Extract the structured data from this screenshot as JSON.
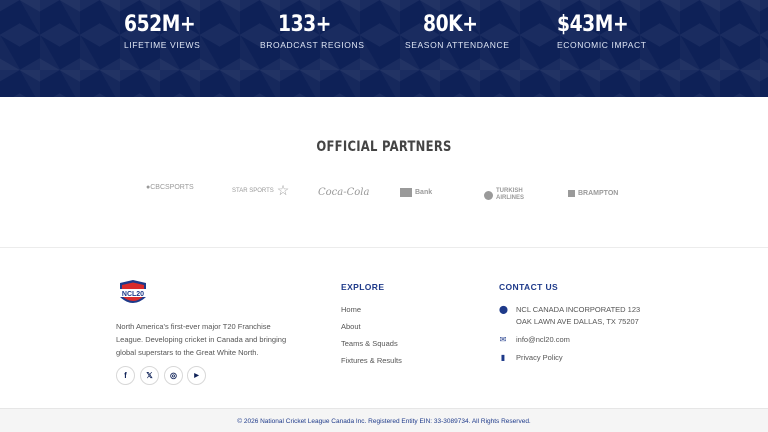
{
  "stats": [
    {
      "value": "652M+",
      "label": "LIFETIME VIEWS"
    },
    {
      "value": "133+",
      "label": "BROADCAST REGIONS"
    },
    {
      "value": "80K+",
      "label": "SEASON ATTENDANCE"
    },
    {
      "value": "$43M+",
      "label": "ECONOMIC IMPACT"
    }
  ],
  "partners": {
    "title": "OFFICIAL PARTNERS",
    "logos": [
      {
        "text": "●CBCSPORTS",
        "icon": "cbc-sports-logo"
      },
      {
        "text": "STAR SPORTS",
        "icon": "star-sports-logo"
      },
      {
        "text": "Coca-Cola",
        "icon": "coca-cola-logo"
      },
      {
        "text": "Bank",
        "icon": "td-bank-logo"
      },
      {
        "text": "TURKISH AIRLINES",
        "icon": "turkish-airlines-logo"
      },
      {
        "text": "BRAMPTON",
        "icon": "brampton-logo"
      }
    ]
  },
  "footer": {
    "about": "North America's first-ever major T20 Franchise League. Developing cricket in Canada and bringing global superstars to the Great White North.",
    "social": [
      {
        "icon": "facebook-icon",
        "glyph": "f"
      },
      {
        "icon": "x-icon",
        "glyph": "𝕏"
      },
      {
        "icon": "instagram-icon",
        "glyph": "◎"
      },
      {
        "icon": "youtube-icon",
        "glyph": "▶"
      }
    ],
    "explore": {
      "title": "EXPLORE",
      "links": [
        "Home",
        "About",
        "Teams & Squads",
        "Fixtures & Results"
      ]
    },
    "contact": {
      "title": "CONTACT US",
      "address": "NCL CANADA INCORPORATED 123 OAK LAWN AVE DALLAS, TX 75207",
      "email": "info@ncl20.com",
      "privacy": "Privacy Policy"
    },
    "copyright": "© 2026 National Cricket League Canada Inc. Registered Entity EIN: 33-3089734. All Rights Reserved."
  },
  "colors": {
    "navy": "#0e2157",
    "accent": "#1e3a8a"
  }
}
